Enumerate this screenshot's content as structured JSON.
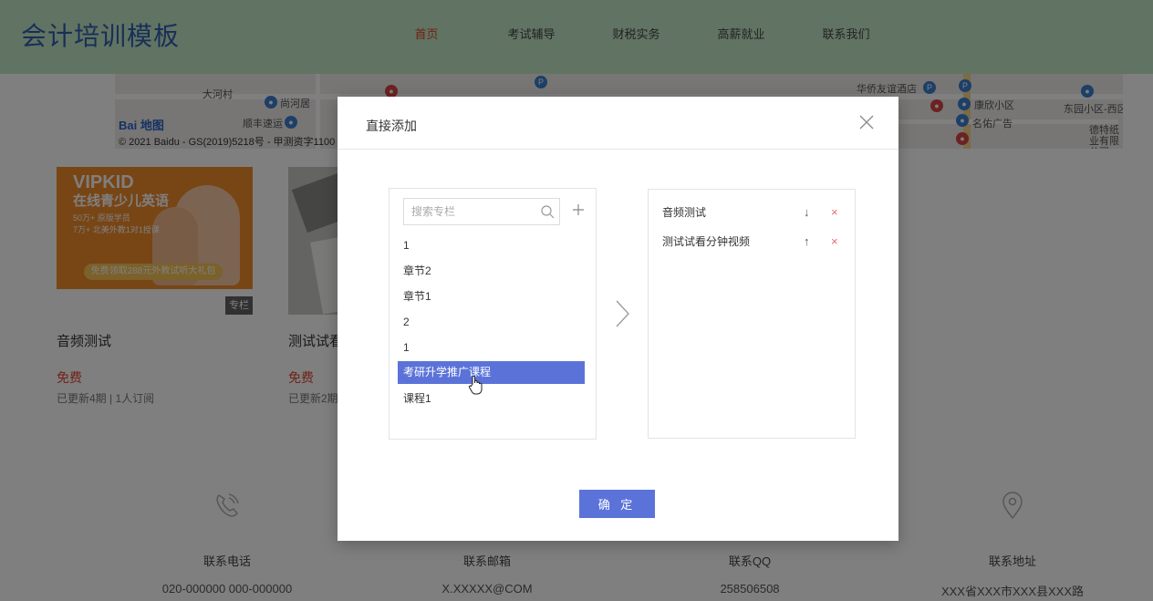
{
  "site": {
    "logo": "会计培训模板",
    "nav": [
      {
        "label": "首页",
        "active": true
      },
      {
        "label": "考试辅导",
        "active": false
      },
      {
        "label": "财税实务",
        "active": false
      },
      {
        "label": "高薪就业",
        "active": false
      },
      {
        "label": "联系我们",
        "active": false
      }
    ]
  },
  "map": {
    "labels": [
      "大河村",
      "尚河居",
      "顺丰速运",
      "华侨友谊酒店",
      "康欣小区",
      "东园小区-西区",
      "名佑广告",
      "德特纸业有限公司"
    ],
    "logo_main": "Bai",
    "logo_accent": "地图",
    "copyright": "© 2021 Baidu - GS(2019)5218号 - 甲测资字1100"
  },
  "courses": [
    {
      "title": "音频测试",
      "price": "免费",
      "meta": "已更新4期 | 1人订阅",
      "badge": "专栏",
      "image_text": {
        "title": "VIPKID",
        "subtitle": "在线青少儿英语",
        "line1": "50万+ 原版学员",
        "line2": "7万+ 北美外教1对1授课",
        "banner": "免费领取288元外教试听大礼包"
      }
    },
    {
      "title": "测试试看",
      "price": "免费",
      "meta": "已更新2期"
    }
  ],
  "contacts": [
    {
      "label": "联系电话",
      "value": "020-000000 000-000000",
      "icon": "phone-icon"
    },
    {
      "label": "联系邮箱",
      "value": "X.XXXXX@COM",
      "icon": "mail-icon"
    },
    {
      "label": "联系QQ",
      "value": "258506508",
      "icon": "qq-icon"
    },
    {
      "label": "联系地址",
      "value": "XXX省XXX市XXX县XXX路",
      "icon": "location-icon"
    }
  ],
  "modal": {
    "title": "直接添加",
    "search_placeholder": "搜索专栏",
    "available": [
      {
        "label": "1",
        "selected": false
      },
      {
        "label": "章节2",
        "selected": false
      },
      {
        "label": "章节1",
        "selected": false
      },
      {
        "label": "2",
        "selected": false
      },
      {
        "label": "1",
        "selected": false
      },
      {
        "label": "考研升学推广课程",
        "selected": true
      },
      {
        "label": "课程1",
        "selected": false
      }
    ],
    "selected": [
      {
        "label": "音频测试",
        "move": "↓",
        "remove": "×"
      },
      {
        "label": "测试试看分钟视频",
        "move": "↑",
        "remove": "×"
      }
    ],
    "confirm_label": "确 定"
  },
  "colors": {
    "header_bg": "#c3e6c5",
    "logo": "#2f5fb0",
    "nav_active": "#e0442e",
    "primary": "#5b73d9",
    "price": "#e0442e",
    "delete": "#e26a7a"
  }
}
